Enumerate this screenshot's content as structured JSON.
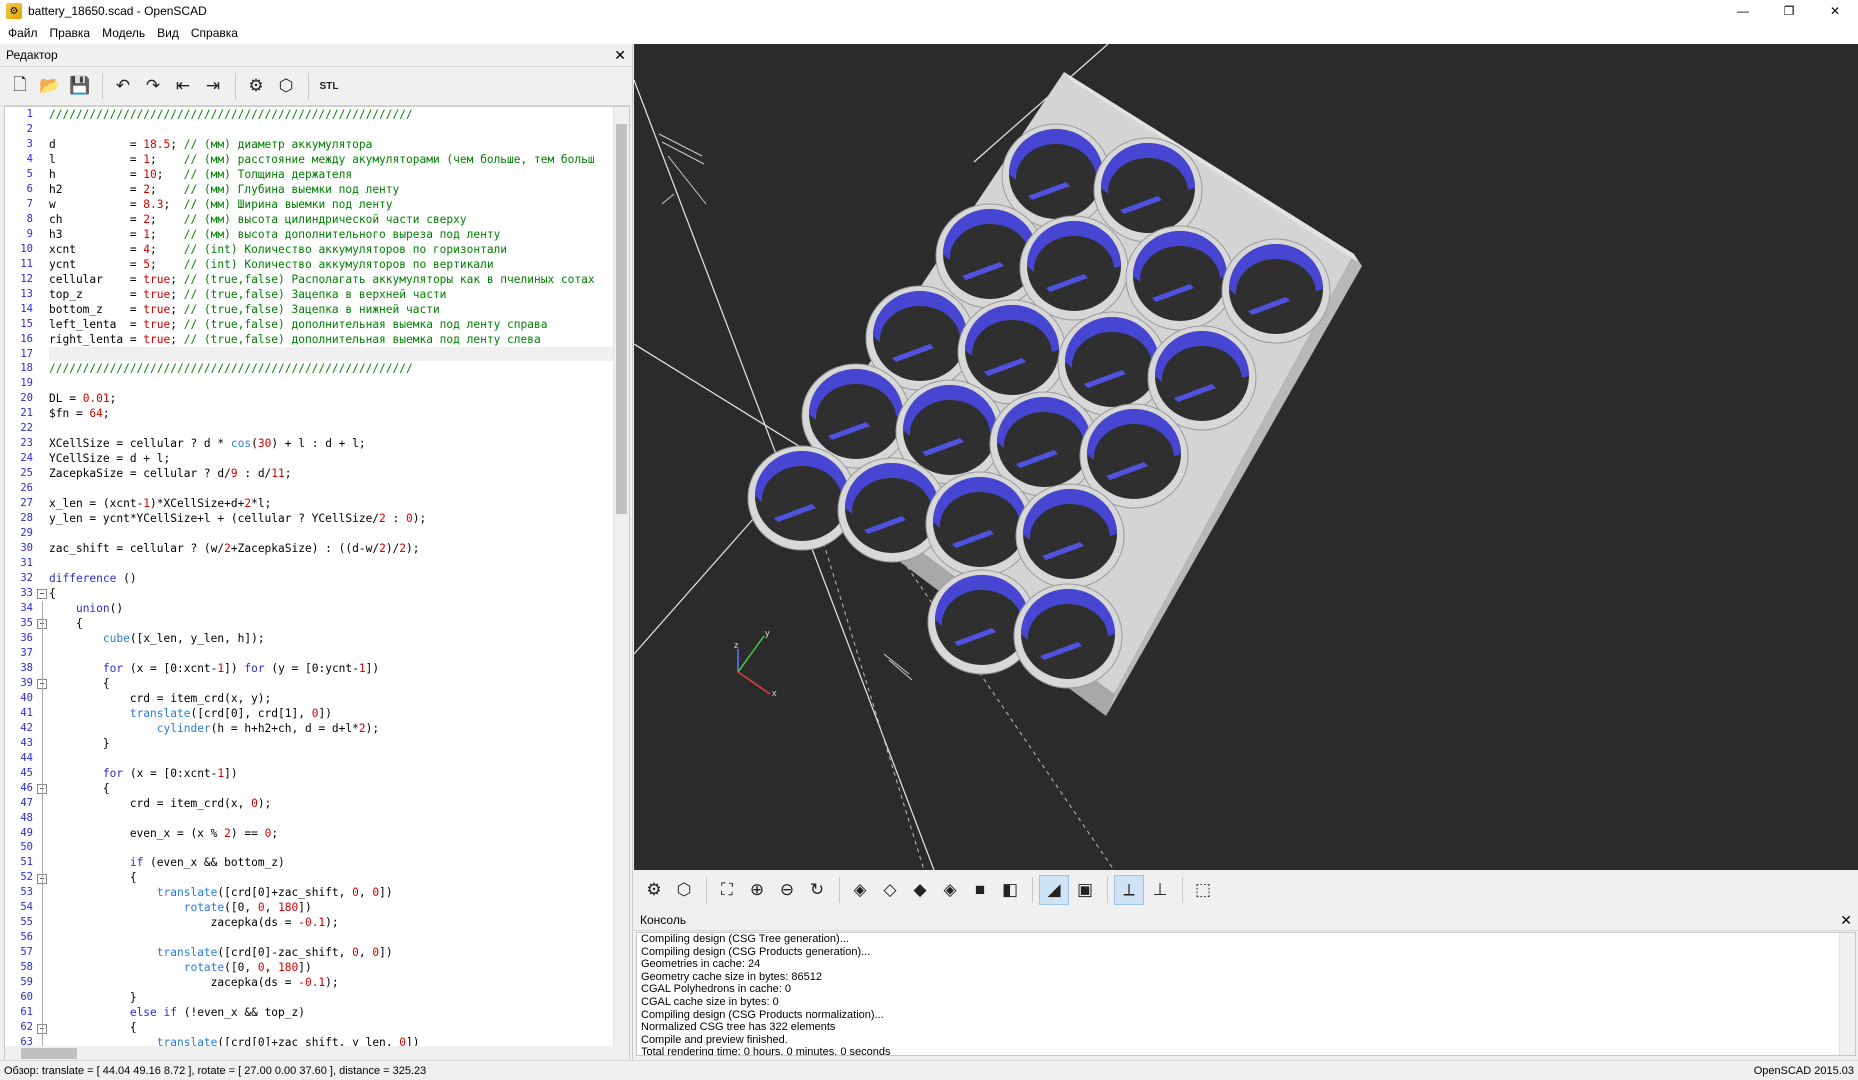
{
  "window": {
    "title": "battery_18650.scad - OpenSCAD",
    "controls": {
      "minimize": "—",
      "maximize": "❐",
      "close": "✕"
    }
  },
  "menu": [
    "Файл",
    "Правка",
    "Модель",
    "Вид",
    "Справка"
  ],
  "editor": {
    "header": "Редактор",
    "close": "✕",
    "toolbar": [
      {
        "name": "new-file-icon",
        "glyph": "🗋"
      },
      {
        "name": "open-file-icon",
        "glyph": "📂"
      },
      {
        "name": "save-file-icon",
        "glyph": "💾"
      },
      {
        "name": "undo-icon",
        "glyph": "↶"
      },
      {
        "name": "redo-icon",
        "glyph": "↷"
      },
      {
        "name": "unindent-icon",
        "glyph": "⇤"
      },
      {
        "name": "indent-icon",
        "glyph": "⇥"
      },
      {
        "name": "preview-icon",
        "glyph": "⚙"
      },
      {
        "name": "render-icon",
        "glyph": "⬡"
      },
      {
        "name": "export-stl-icon",
        "glyph": "STL"
      }
    ],
    "lines": [
      "//////////////////////////////////////////////////////",
      "",
      "d           = 18.5; // (мм) диаметр аккумулятора",
      "l           = 1;    // (мм) расстояние между акумуляторами (чем больше, тем больш",
      "h           = 10;   // (мм) Толщина держателя",
      "h2          = 2;    // (мм) Глубина выемки под ленту",
      "w           = 8.3;  // (мм) Ширина выемки под ленту",
      "ch          = 2;    // (мм) высота цилиндрической части сверху",
      "h3          = 1;    // (мм) высота дополнительного выреза под ленту",
      "xcnt        = 4;    // (int) Количество аккумуляторов по горизонтали",
      "ycnt        = 5;    // (int) Количество аккумуляторов по вертикали",
      "cellular    = true; // (true,false) Располагать аккумуляторы как в пчелиных сотах",
      "top_z       = true; // (true,false) Зацепка в верхней части",
      "bottom_z    = true; // (true,false) Зацепка в нижней части",
      "left_lenta  = true; // (true,false) дополнительная выемка под ленту справа",
      "right_lenta = true; // (true,false) дополнительная выемка под ленту слева",
      "",
      "//////////////////////////////////////////////////////",
      "",
      "DL = 0.01;",
      "$fn = 64;",
      "",
      "XCellSize = cellular ? d * cos(30) + l : d + l;",
      "YCellSize = d + l;",
      "ZacepkaSize = cellular ? d/9 : d/11;",
      "",
      "x_len = (xcnt-1)*XCellSize+d+2*l;",
      "y_len = ycnt*YCellSize+l + (cellular ? YCellSize/2 : 0);",
      "",
      "zac_shift = cellular ? (w/2+ZacepkaSize) : ((d-w/2)/2);",
      "",
      "difference ()",
      "{",
      "    union()",
      "    {",
      "        cube([x_len, y_len, h]);",
      "",
      "        for (x = [0:xcnt-1]) for (y = [0:ycnt-1])",
      "        {",
      "            crd = item_crd(x, y);",
      "            translate([crd[0], crd[1], 0])",
      "                cylinder(h = h+h2+ch, d = d+l*2);",
      "        }",
      "",
      "        for (x = [0:xcnt-1])",
      "        {",
      "            crd = item_crd(x, 0);",
      "",
      "            even_x = (x % 2) == 0;",
      "",
      "            if (even_x && bottom_z)",
      "            {",
      "                translate([crd[0]+zac_shift, 0, 0])",
      "                    rotate([0, 0, 180])",
      "                        zacepka(ds = -0.1);",
      "",
      "                translate([crd[0]-zac_shift, 0, 0])",
      "                    rotate([0, 0, 180])",
      "                        zacepka(ds = -0.1);",
      "            }",
      "            else if (!even_x && top_z)",
      "            {",
      "                translate([crd[0]+zac_shift, y_len, 0])"
    ],
    "fold_lines": [
      33,
      35,
      39,
      46,
      52,
      62
    ],
    "current_line": 17
  },
  "view_toolbar": [
    {
      "name": "preview-icon",
      "glyph": "⚙"
    },
    {
      "name": "render-icon",
      "glyph": "⬡"
    },
    {
      "name": "view-all-icon",
      "glyph": "⛶"
    },
    {
      "name": "zoom-in-icon",
      "glyph": "⊕"
    },
    {
      "name": "zoom-out-icon",
      "glyph": "⊖"
    },
    {
      "name": "reset-view-icon",
      "glyph": "↻"
    },
    {
      "name": "view-right-icon",
      "glyph": "◈"
    },
    {
      "name": "view-top-icon",
      "glyph": "◇"
    },
    {
      "name": "view-bottom-icon",
      "glyph": "◆"
    },
    {
      "name": "view-left-icon",
      "glyph": "◈"
    },
    {
      "name": "view-front-icon",
      "glyph": "■"
    },
    {
      "name": "view-back-icon",
      "glyph": "◧"
    },
    {
      "name": "perspective-icon",
      "glyph": "◢"
    },
    {
      "name": "orthogonal-icon",
      "glyph": "▣"
    },
    {
      "name": "show-axes-icon",
      "glyph": "⟂"
    },
    {
      "name": "show-scale-icon",
      "glyph": "⊥"
    },
    {
      "name": "show-edges-icon",
      "glyph": "⬚"
    }
  ],
  "console": {
    "header": "Консоль",
    "close": "✕",
    "lines": [
      "Compiling design (CSG Tree generation)...",
      "Compiling design (CSG Products generation)...",
      "Geometries in cache: 24",
      "Geometry cache size in bytes: 86512",
      "CGAL Polyhedrons in cache: 0",
      "CGAL cache size in bytes: 0",
      "Compiling design (CSG Products normalization)...",
      "Normalized CSG tree has 322 elements",
      "Compile and preview finished.",
      "Total rendering time: 0 hours, 0 minutes, 0 seconds"
    ]
  },
  "status": {
    "left": "Обзор: translate = [ 44.04 49.16 8.72 ], rotate = [ 27.00 0.00 37.60 ], distance = 325.23",
    "right": "OpenSCAD 2015.03"
  },
  "axes": {
    "x": "x",
    "y": "y",
    "z": "z"
  },
  "colors": {
    "model_body": "#d8d8d8",
    "model_holes": "#4646d2",
    "viewport_bg": "#2b2b2b"
  }
}
